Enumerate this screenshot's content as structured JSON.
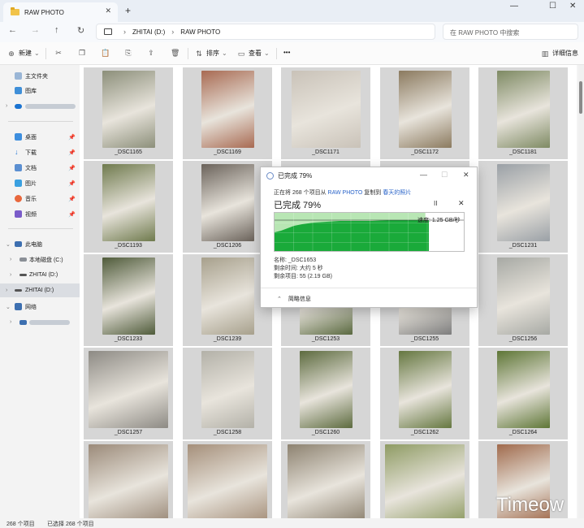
{
  "window": {
    "tab_title": "RAW PHOTO",
    "tab_close": "✕",
    "new_tab": "+",
    "minimize": "—",
    "maximize": "☐",
    "close": "✕"
  },
  "address": {
    "crumbs": [
      "ZHITAI (D:)",
      "RAW PHOTO"
    ],
    "chevron": "›",
    "search_placeholder": "在 RAW PHOTO 中搜索"
  },
  "toolbar": {
    "new_label": "新建",
    "sort_label": "排序",
    "view_label": "查看",
    "more_label": "•••",
    "details_label": "详细信息"
  },
  "sidebar": {
    "home": "主文件夹",
    "gallery": "图库",
    "desktop": "桌面",
    "downloads": "下载",
    "documents": "文档",
    "pictures": "图片",
    "music": "音乐",
    "videos": "视频",
    "this_pc": "此电脑",
    "local_disk": "本地磁盘 (C:)",
    "zhitai1": "ZHITAI (D:)",
    "zhitai2": "ZHITAI (D:)",
    "network": "网络"
  },
  "files": [
    "_DSC1165",
    "_DSC1169",
    "_DSC1171",
    "_DSC1172",
    "_DSC1181",
    "_DSC1193",
    "_DSC1206",
    "",
    "",
    "_DSC1231",
    "_DSC1233",
    "_DSC1239",
    "_DSC1253",
    "_DSC1255",
    "_DSC1256",
    "_DSC1257",
    "_DSC1258",
    "_DSC1260",
    "_DSC1262",
    "_DSC1264",
    "",
    "",
    "",
    "",
    ""
  ],
  "status": {
    "count": "268 个项目",
    "selected": "已选择 268 个项目"
  },
  "watermark": "Timeow",
  "dialog": {
    "title": "已完成 79%",
    "line_prefix": "正在将 268 个项目从",
    "from": "RAW PHOTO",
    "line_mid": "复制到",
    "to": "春天的照片",
    "percent_heading": "已完成 79%",
    "progress_percent": 79,
    "pause": "II",
    "cancel": "✕",
    "speed": "速度: 1.25 GB/秒",
    "name": "名称: _DSC1653",
    "time_left": "剩余时间: 大约 5 秒",
    "items_left": "剩余项目: 55 (2.19 GB)",
    "less_info": "简略信息",
    "minimize": "—",
    "maximize": "☐",
    "close": "✕"
  }
}
